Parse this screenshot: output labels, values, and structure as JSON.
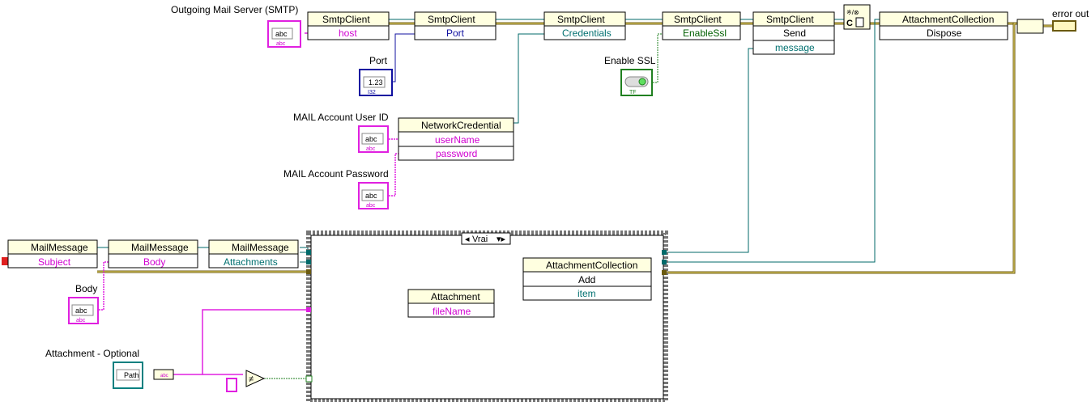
{
  "controls": {
    "smtp_server": "Outgoing Mail Server (SMTP)",
    "port": "Port",
    "enable_ssl": "Enable SSL",
    "user_id": "MAIL Account User ID",
    "password": "MAIL Account Password",
    "body": "Body",
    "attachment": "Attachment - Optional",
    "error_out": "error out"
  },
  "nodes": {
    "smtp1": {
      "title": "SmtpClient",
      "pin": "host"
    },
    "smtp2": {
      "title": "SmtpClient",
      "pin": "Port"
    },
    "smtp3": {
      "title": "SmtpClient",
      "pin": "Credentials"
    },
    "smtp4": {
      "title": "SmtpClient",
      "pin": "EnableSsl"
    },
    "smtp5": {
      "title": "SmtpClient",
      "method": "Send",
      "pin": "message"
    },
    "attcoll_dispose": {
      "title": "AttachmentCollection",
      "method": "Dispose"
    },
    "netcred": {
      "title": "NetworkCredential",
      "pin1": "userName",
      "pin2": "password"
    },
    "mail1": {
      "title": "MailMessage",
      "pin": "Subject"
    },
    "mail2": {
      "title": "MailMessage",
      "pin": "Body"
    },
    "mail3": {
      "title": "MailMessage",
      "pin": "Attachments"
    },
    "attcoll_add": {
      "title": "AttachmentCollection",
      "method": "Add",
      "pin": "item"
    },
    "attachment": {
      "title": "Attachment",
      "pin": "fileName"
    }
  },
  "case_structure": {
    "selector": "Vrai"
  },
  "terminal_glyphs": {
    "string": "abc",
    "numeric": "1.23",
    "path": "Path",
    "i32": "I32",
    "tf": "TF"
  },
  "colors": {
    "string_wire": "#e020e0",
    "numeric_wire": "#1010a0",
    "refnum_wire": "#006a6a",
    "boolean_wire": "#208020",
    "error_wire": "#6b5a10",
    "path_wire": "#008080"
  }
}
